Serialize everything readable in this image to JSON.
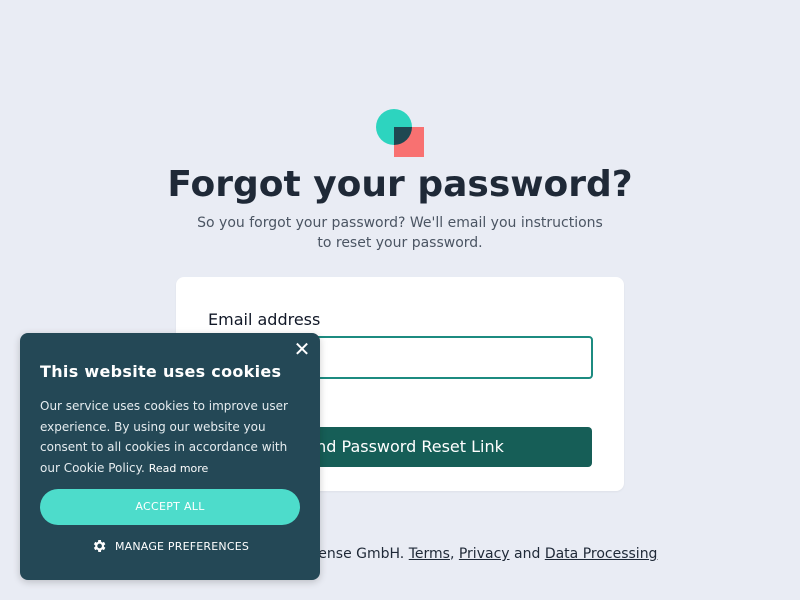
{
  "brand": {
    "colors": {
      "accent": "#165e57",
      "teal": "#2dd4bf",
      "coral": "#f87171",
      "cookie_bg": "#244856",
      "accept_bg": "#4ddccb"
    },
    "logo_icon": "logo-shapes-icon"
  },
  "page": {
    "title": "Forgot your password?",
    "subtitle": "So you forgot your password? We'll email you instructions to reset your password."
  },
  "form": {
    "email_label": "Email address",
    "email_value": "",
    "email_placeholder": "",
    "submit_label": "Send Password Reset Link"
  },
  "footer": {
    "text": "is a trademark of stereosense GmbH.",
    "terms": "Terms",
    "comma": ",",
    "privacy": "Privacy",
    "and": "and",
    "data_processing": "Data Processing"
  },
  "cookie_banner": {
    "close_icon": "close-icon",
    "title": "This website uses cookies",
    "body": "Our service uses cookies to improve user experience. By using our website you consent to all cookies in accordance with our Cookie Policy.",
    "read_more": "Read more",
    "accept_label": "ACCEPT ALL",
    "manage_icon": "gear-icon",
    "manage_label": "MANAGE PREFERENCES"
  }
}
